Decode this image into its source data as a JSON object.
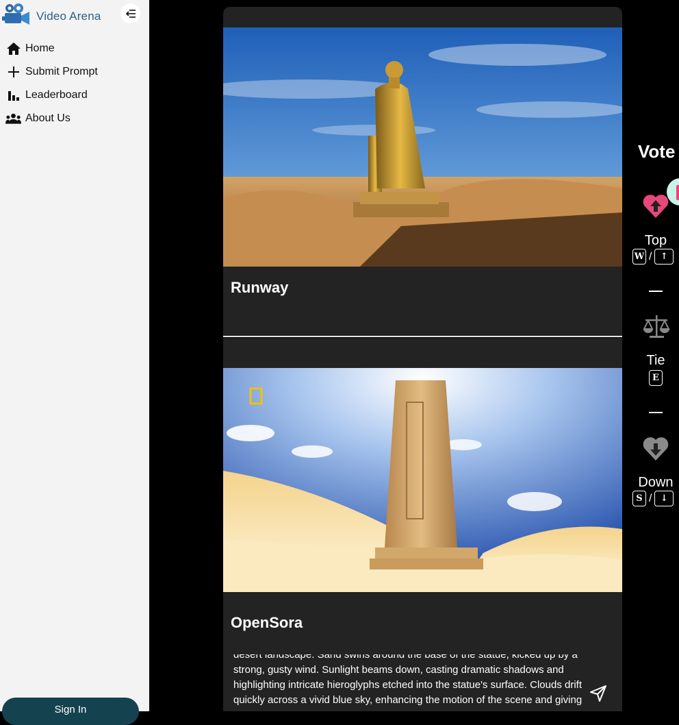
{
  "app": {
    "brand": "Video Arena"
  },
  "sidebar": {
    "items": [
      {
        "label": "Home",
        "icon": "home-icon"
      },
      {
        "label": "Submit Prompt",
        "icon": "plus-icon"
      },
      {
        "label": "Leaderboard",
        "icon": "bar-chart-icon"
      },
      {
        "label": "About Us",
        "icon": "group-icon"
      }
    ],
    "sign_in": "Sign In"
  },
  "videos": [
    {
      "model": "Runway",
      "description": "golden statue in desert"
    },
    {
      "model": "OpenSora",
      "description": "sandstone obelisk with hieroglyphs"
    }
  ],
  "prompt": {
    "lines": [
      "desert landscape. Sand swirls around the base of the statue, kicked up by a",
      "strong, gusty wind. Sunlight beams down, casting dramatic shadows and",
      "highlighting intricate hieroglyphs etched into the statue's surface. Clouds drift",
      "quickly across a vivid blue sky, enhancing the motion of the scene and giving"
    ]
  },
  "vote": {
    "title": "Vote",
    "top": {
      "label": "Top",
      "key1": "W",
      "key2": "↑"
    },
    "tie": {
      "label": "Tie",
      "key1": "E"
    },
    "down": {
      "label": "Down",
      "key1": "S",
      "key2": "↓"
    },
    "separator": "/"
  },
  "colors": {
    "sidebar_bg": "#f3f3f3",
    "card_bg": "#232323",
    "heart_pink": "#e8477a",
    "sign_in_bg": "#14434f"
  }
}
